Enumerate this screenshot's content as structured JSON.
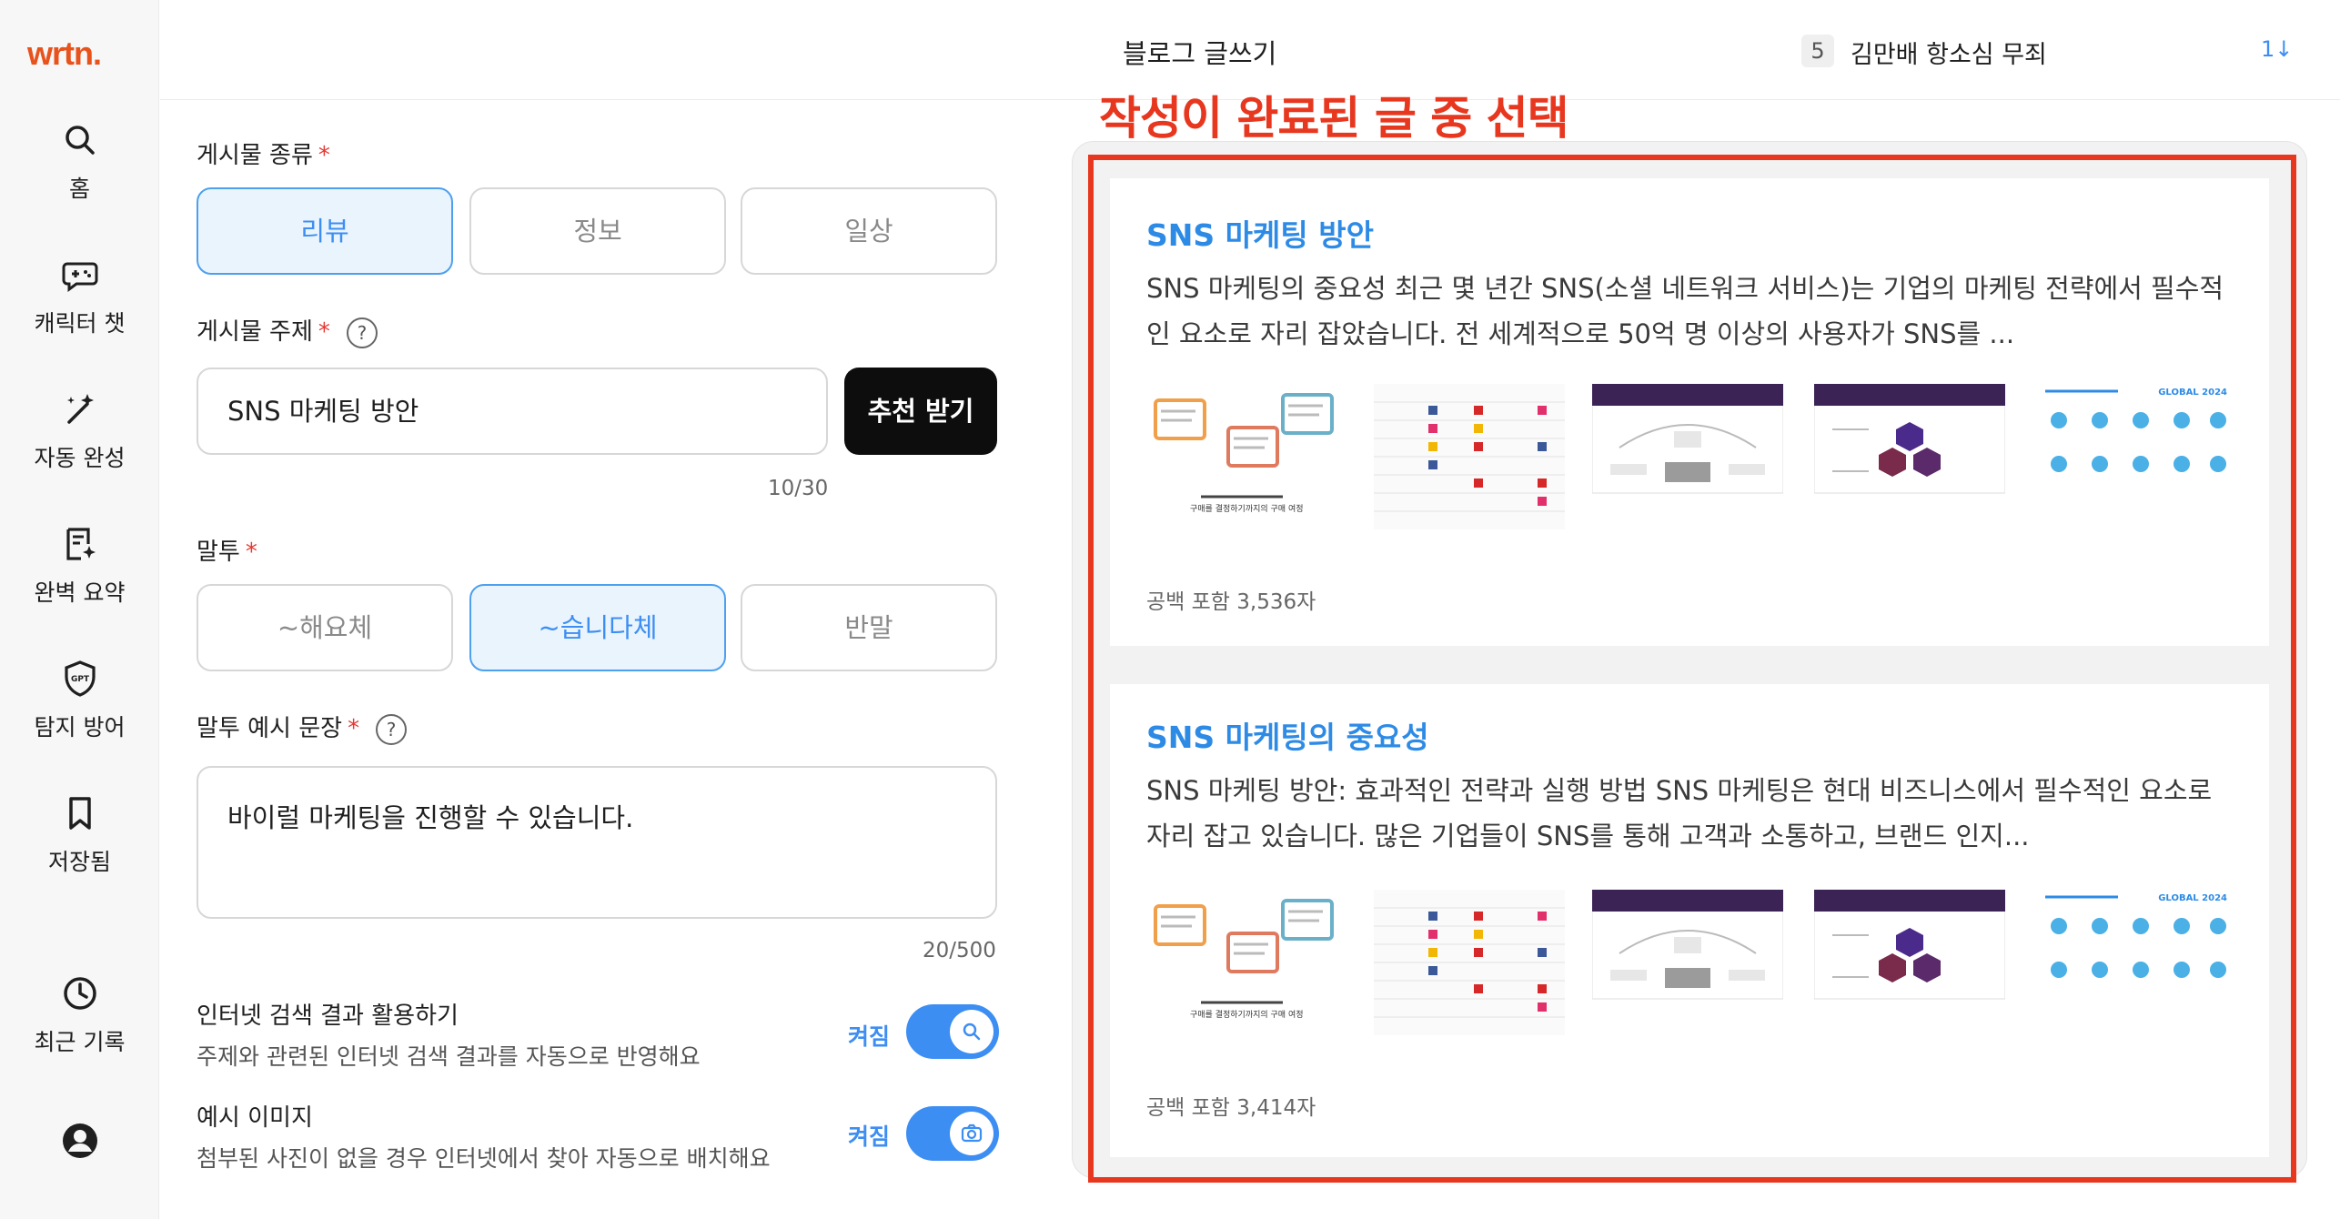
{
  "app": {
    "logo": "wrtn."
  },
  "sidebar": {
    "items": [
      {
        "label": "홈",
        "icon": "search-icon"
      },
      {
        "label": "캐릭터 챗",
        "icon": "gamepad-chat-icon"
      },
      {
        "label": "자동 완성",
        "icon": "magic-wand-icon"
      },
      {
        "label": "완벽 요약",
        "icon": "document-sparkle-icon"
      },
      {
        "label": "탐지 방어",
        "icon": "gpt-shield-icon"
      },
      {
        "label": "저장됨",
        "icon": "bookmark-icon"
      },
      {
        "label": "최근 기록",
        "icon": "clock-icon"
      }
    ],
    "profile_icon": "user-circle-icon"
  },
  "header": {
    "title": "블로그 글쓰기",
    "user_badge": "5",
    "user_name": "김만배 항소심 무죄",
    "sort_label": "1↓"
  },
  "form": {
    "post_type": {
      "label": "게시물 종류",
      "required": "*",
      "options": [
        "리뷰",
        "정보",
        "일상"
      ],
      "selected": "리뷰"
    },
    "topic": {
      "label": "게시물 주제",
      "required": "*",
      "value": "SNS 마케팅 방안",
      "counter": "10/30",
      "recommend_button": "추천 받기"
    },
    "tone": {
      "label": "말투",
      "required": "*",
      "options": [
        "~해요체",
        "~습니다체",
        "반말"
      ],
      "selected": "~습니다체"
    },
    "tone_example": {
      "label": "말투 예시 문장",
      "required": "*",
      "value": "바이럴 마케팅을 진행할 수 있습니다.",
      "counter": "20/500"
    },
    "web_search": {
      "title": "인터넷 검색 결과 활용하기",
      "desc": "주제와 관련된 인터넷 검색 결과를 자동으로 반영해요",
      "state": "켜짐"
    },
    "example_image": {
      "title": "예시 이미지",
      "desc": "첨부된 사진이 없을 경우 인터넷에서 찾아 자동으로 배치해요",
      "state": "켜짐"
    }
  },
  "annotation": {
    "text": "작성이 완료된 글 중 선택"
  },
  "results": [
    {
      "title": "SNS 마케팅 방안",
      "body": "SNS 마케팅의 중요성 최근 몇 년간 SNS(소셜 네트워크 서비스)는 기업의 마케팅 전략에서 필수적인 요소로 자리 잡았습니다. 전 세계적으로 50억 명 이상의 사용자가 SNS를 ...",
      "count": "공백 포함 3,536자"
    },
    {
      "title": "SNS 마케팅의 중요성",
      "body": "SNS 마케팅 방안: 효과적인 전략과 실행 방법 SNS 마케팅은 현대 비즈니스에서 필수적인 요소로 자리 잡고 있습니다. 많은 기업들이 SNS를 통해 고객과 소통하고, 브랜드 인지...",
      "count": "공백 포함 3,414자"
    }
  ],
  "thumbnails": [
    {
      "icon": "step-diagram-thumbnail",
      "caption": "구매를 결정하기까지의 구매 여정"
    },
    {
      "icon": "sns-table-thumbnail"
    },
    {
      "icon": "purple-slide-diagram-thumbnail"
    },
    {
      "icon": "purple-hexagon-slide-thumbnail"
    },
    {
      "icon": "global-stats-infographic-thumbnail",
      "caption": "GLOBAL 2024"
    }
  ],
  "colors": {
    "accent": "#3d8ef3",
    "brand": "#e8521b",
    "annotation": "#e8371f",
    "title_blue": "#2d8be6"
  }
}
